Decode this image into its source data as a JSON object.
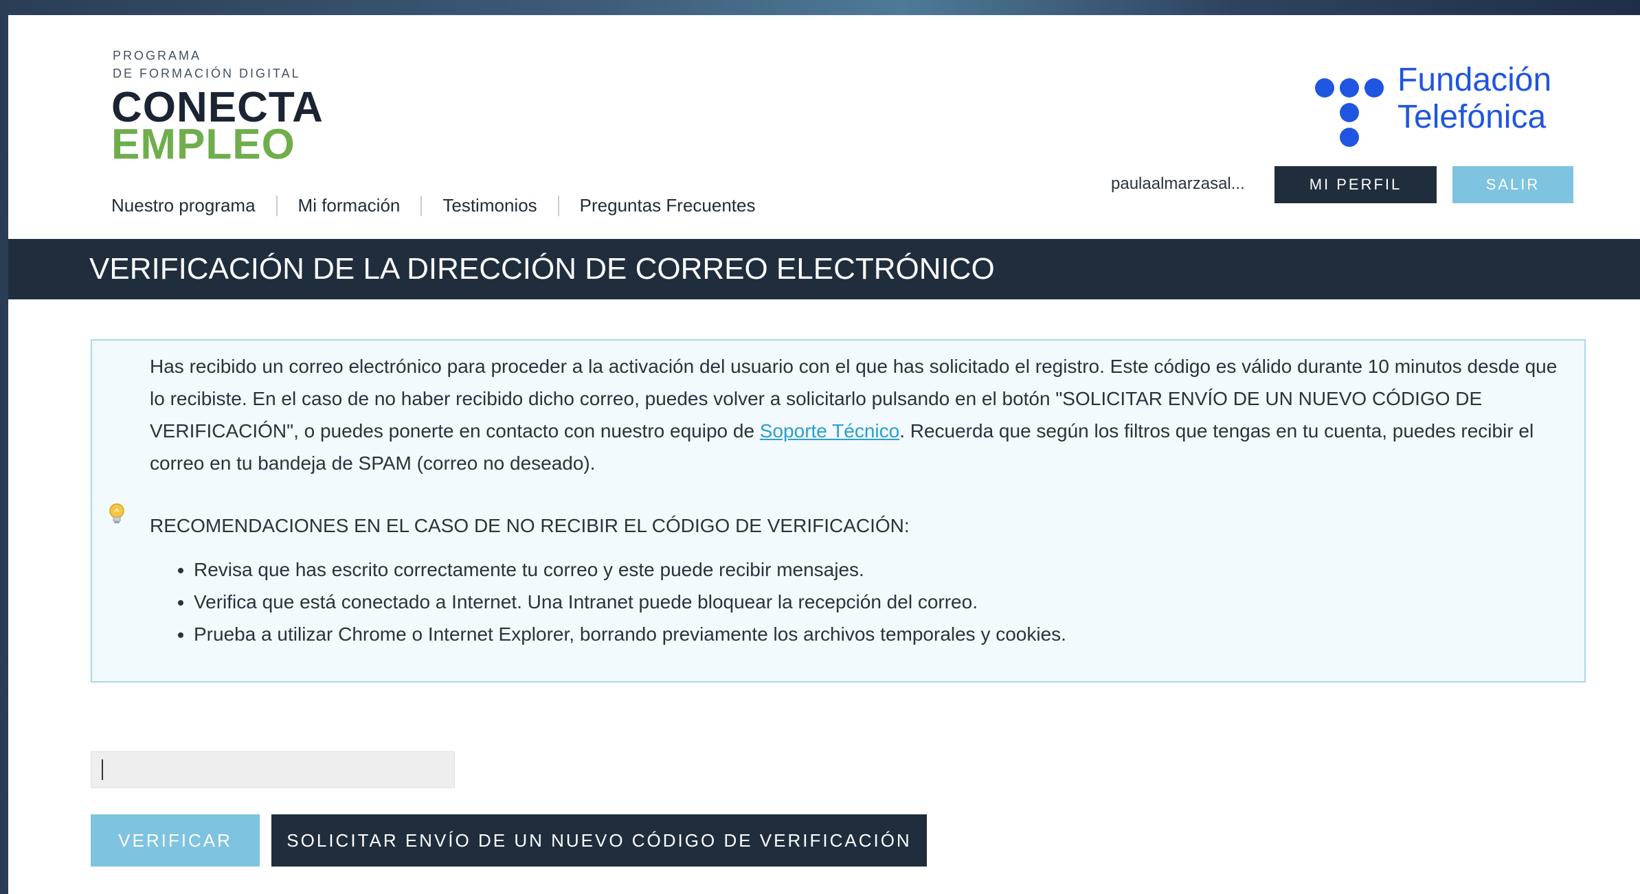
{
  "brand": {
    "kicker_line1": "PROGRAMA",
    "kicker_line2": "DE FORMACIÓN DIGITAL",
    "name_line1": "CONECTA",
    "name_line2": "EMPLEO",
    "name_line1_color": "#1b2433",
    "name_line2_color": "#6fae4c"
  },
  "nav": {
    "items": [
      {
        "label": "Nuestro programa"
      },
      {
        "label": "Mi formación"
      },
      {
        "label": "Testimonios"
      },
      {
        "label": "Preguntas Frecuentes"
      }
    ]
  },
  "sponsor": {
    "line1": "Fundación",
    "line2": "Telefónica",
    "color": "#1f55e0"
  },
  "user": {
    "name": "paulaalmarzasal...",
    "profile_button": "MI PERFIL",
    "logout_button": "SALIR"
  },
  "page": {
    "title": "VERIFICACIÓN DE LA DIRECCIÓN DE CORREO ELECTRÓNICO"
  },
  "info": {
    "text_before_link": "Has recibido un correo electrónico para proceder a la activación del usuario con el que has solicitado el registro. Este código es válido durante 10 minutos desde que lo recibiste. En el caso de no haber recibido dicho correo, puedes volver a solicitarlo pulsando en el botón \"SOLICITAR ENVÍO DE UN NUEVO CÓDIGO DE VERIFICACIÓN\", o puedes ponerte en contacto con nuestro equipo de ",
    "link_text": "Soporte Técnico",
    "text_after_link": ". Recuerda que según los filtros que tengas en tu cuenta, puedes recibir el correo en tu bandeja de SPAM (correo no deseado).",
    "icon": "lightbulb-icon",
    "recommendations_title": "RECOMENDACIONES EN EL CASO DE NO RECIBIR EL CÓDIGO DE VERIFICACIÓN:",
    "recommendations": [
      "Revisa que has escrito correctamente tu correo y este puede recibir mensajes.",
      "Verifica que está conectado a Internet. Una Intranet puede bloquear la recepción del correo.",
      "Prueba a utilizar Chrome o Internet Explorer, borrando previamente los archivos temporales y cookies."
    ]
  },
  "form": {
    "code_value": "",
    "code_placeholder": "",
    "verify_button": "VERIFICAR",
    "resend_button": "SOLICITAR ENVÍO DE UN NUEVO CÓDIGO DE VERIFICACIÓN"
  },
  "colors": {
    "dark_navy": "#1f2d3d",
    "light_blue": "#7ec3df",
    "info_bg": "#f2fafd",
    "info_border": "#a9d8ea",
    "link": "#2a9ed0"
  }
}
